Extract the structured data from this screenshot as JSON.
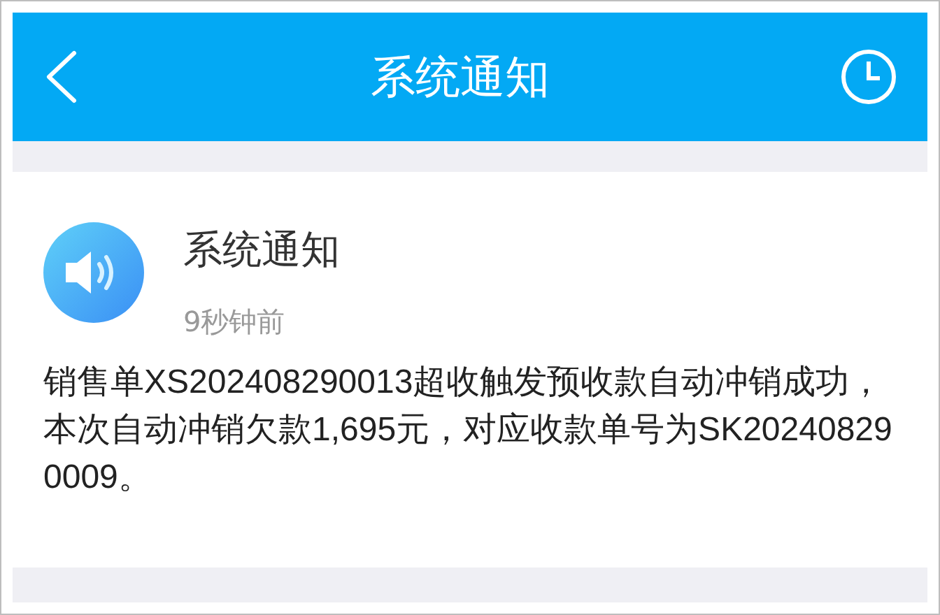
{
  "header": {
    "title": "系统通知"
  },
  "notification": {
    "title": "系统通知",
    "time": "9秒钟前",
    "message": "销售单XS202408290013超收触发预收款自动冲销成功，本次自动冲销欠款1,695元，对应收款单号为SK202408290009。"
  }
}
